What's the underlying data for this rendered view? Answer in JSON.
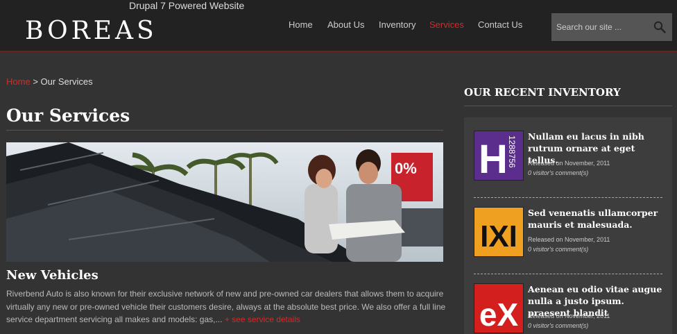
{
  "header": {
    "tagline": "Drupal 7 Powered Website",
    "logo": "BOREAS",
    "nav": [
      {
        "label": "Home"
      },
      {
        "label": "About Us"
      },
      {
        "label": "Inventory"
      },
      {
        "label": "Services"
      },
      {
        "label": "Contact Us"
      }
    ],
    "active_nav": "Services",
    "search_placeholder": "Search our site ..."
  },
  "breadcrumb": {
    "home": "Home",
    "separator": ">",
    "current": "Our Services"
  },
  "main": {
    "title": "Our Services",
    "section_title": "New Vehicles",
    "description": "Riverbend Auto is also known for their exclusive network of new and pre-owned car dealers that allows them to acquire virtually any new or pre-owned vehicle their customers desire, always at the absolute best price. We also offer a full line service department servicing all makes and models: gas,...",
    "more_link": "+ see service details"
  },
  "sidebar": {
    "title": "OUR RECENT INVENTORY",
    "items": [
      {
        "title": "Nullam eu lacus in nibh rutrum ornare at eget tellus.",
        "released": "Released on November, 2011",
        "comments": "0 visitor's comment(s)",
        "thumb_text": "H",
        "thumb_side_text": "1288756",
        "thumb_color": "#5b2d8c"
      },
      {
        "title": "Sed venenatis ullamcorper mauris et malesuada.",
        "released": "Released on November, 2011",
        "comments": "0 visitor's comment(s)",
        "thumb_text": "IXI",
        "thumb_color": "#f0a020"
      },
      {
        "title": "Aenean eu odio vitae augue nulla a justo ipsum. praesent blandit",
        "released": "Released on November, 2011",
        "comments": "0 visitor's comment(s)",
        "thumb_text": "eX",
        "thumb_color": "#d41f1f"
      }
    ]
  },
  "colors": {
    "accent": "#d42a2a",
    "background": "#333333",
    "header": "#222222"
  },
  "icons": {
    "search": "magnifier-icon"
  }
}
